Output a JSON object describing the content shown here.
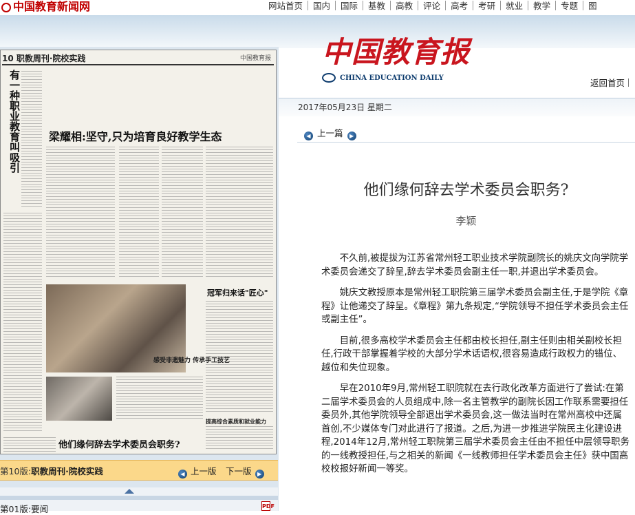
{
  "site": {
    "logo_text": "中国教育新闻网"
  },
  "topnav": {
    "items": [
      "网站首页",
      "国内",
      "国际",
      "基教",
      "高教",
      "评论",
      "高考",
      "考研",
      "就业",
      "教学",
      "专题",
      "图"
    ]
  },
  "newspaper": {
    "brand_name": "中国教育报",
    "brand_sub": "CHINA EDUCATION DAILY",
    "back_home": "返回首页",
    "date": "2017年05月23日  星期二"
  },
  "page_preview": {
    "section_label": "10 职教周刊·院校实践",
    "masthead_small": "中国教育报",
    "vertical_title": "有一种职业教育叫吸引",
    "headline": "梁耀相:坚守,只为培育良好教学生态",
    "subhead": "冠军归来话\"匠心\"",
    "photo_caption": "感受非遗魅力 传承手工技艺",
    "column_caption": "提高综合素质和就业能力",
    "bottom_headline": "他们缘何辞去学术委员会职务?"
  },
  "edition_bar": {
    "current_prefix": "第10版:",
    "current_name": "职教周刊·院校实践",
    "prev_label": "上一版",
    "next_label": "下一版"
  },
  "page_list": {
    "first_item": "第01版:要闻",
    "pdf_label": "PDF"
  },
  "article": {
    "prev_label": "上一篇",
    "title": "他们缘何辞去学术委员会职务?",
    "author": "李颖",
    "paragraphs": [
      "不久前,被提拔为江苏省常州轻工职业技术学院副院长的姚庆文向学院学术委员会递交了辞呈,辞去学术委员会副主任一职,并退出学术委员会。",
      "姚庆文教授原本是常州轻工职院第三届学术委员会副主任,于是学院《章程》让他递交了辞呈。《章程》第九条规定,“学院领导不担任学术委员会主任或副主任”。",
      "目前,很多高校学术委员会主任都由校长担任,副主任则由相关副校长担任,行政干部掌握着学校的大部分学术话语权,很容易造成行政权力的错位、越位和失位现象。",
      "早在2010年9月,常州轻工职院就在去行政化改革方面进行了尝试:在第二届学术委员会的人员组成中,除一名主管教学的副院长因工作联系需要担任委员外,其他学院领导全部退出学术委员会,这一做法当时在常州高校中还属首创,不少媒体专门对此进行了报道。之后,为进一步推进学院民主化建设进程,2014年12月,常州轻工职院第三届学术委员会主任由不担任中层领导职务的一线教授担任,与之相关的新闻《一线教师担任学术委员会主任》获中国高校校报好新闻一等奖。"
    ]
  },
  "colors": {
    "brand_red": "#c9151e",
    "link_blue": "#12406f",
    "edition_bar": "#fbd88a"
  }
}
